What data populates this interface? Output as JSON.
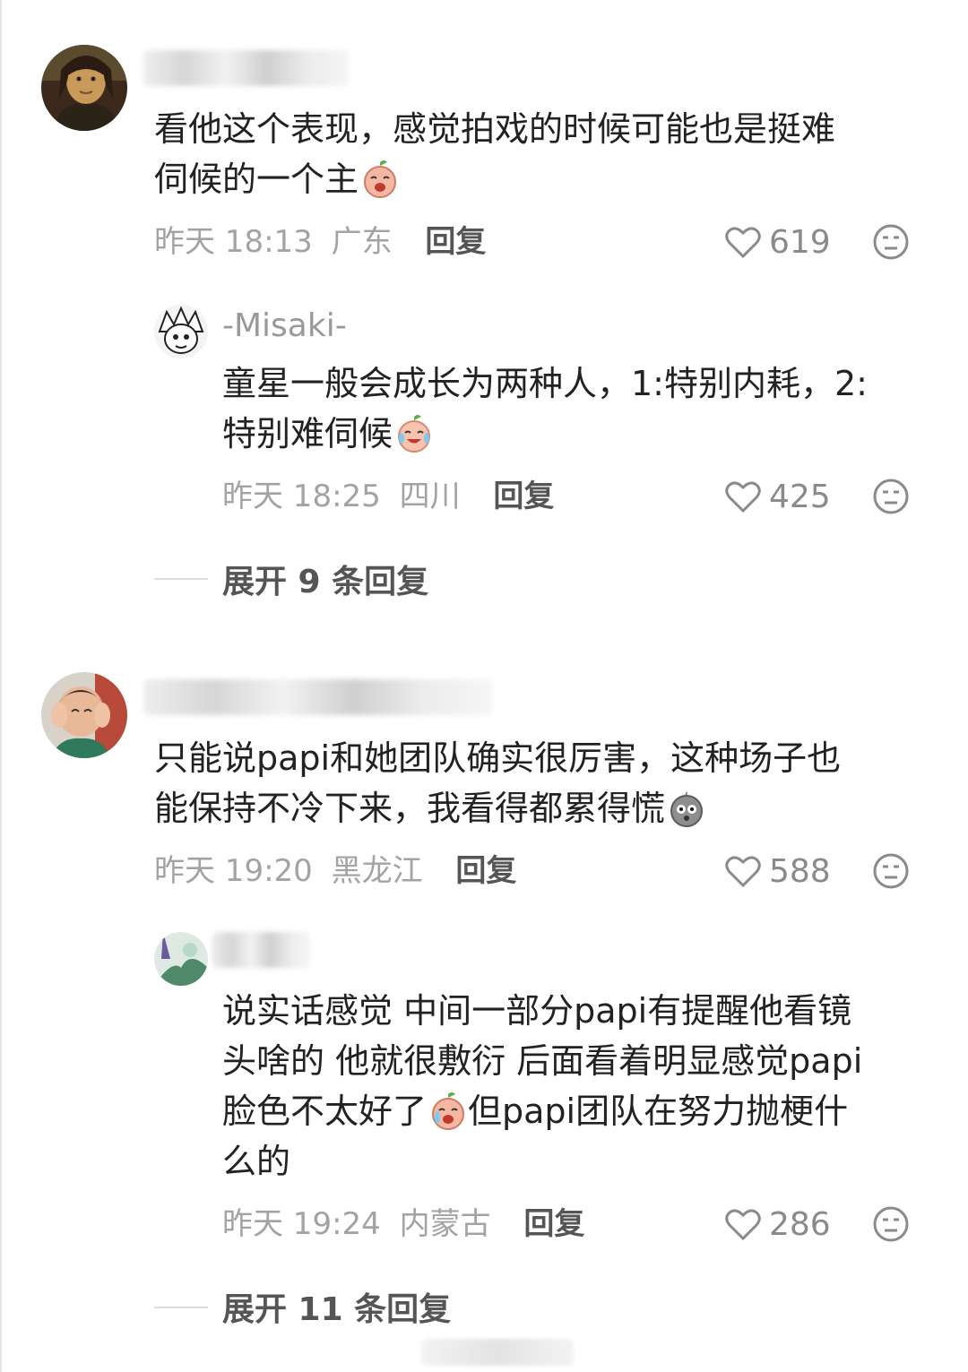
{
  "comments": [
    {
      "text_lines": [
        "看他这个表现，感觉拍戏的时候可能也是挺难",
        "伺候的一个主"
      ],
      "sticker": "crying-peach-emoji",
      "time": "昨天 18:13",
      "location": "广东",
      "reply_label": "回复",
      "likes": "619",
      "replies": [
        {
          "username": "-Misaki-",
          "text_lines": [
            "童星一般会成长为两种人，1:特别内耗，2:",
            "特别难伺候"
          ],
          "sticker": "laugh-cry-peach-emoji",
          "time": "昨天 18:25",
          "location": "四川",
          "reply_label": "回复",
          "likes": "425"
        }
      ],
      "expand_label": "展开 9 条回复"
    },
    {
      "text_lines": [
        "只能说papi和她团队确实很厉害，这种场子也",
        "能保持不冷下来，我看得都累得慌"
      ],
      "sticker": "shocked-bird-emoji",
      "time": "昨天 19:20",
      "location": "黑龙江",
      "reply_label": "回复",
      "likes": "588",
      "replies": [
        {
          "text_lines": [
            "说实话感觉 中间一部分papi有提醒他看镜",
            "头啥的 他就很敷衍 后面看着明显感觉papi",
            "脸色不太好了",
            "但papi团队在努力抛梗什",
            "么的"
          ],
          "sticker": "crying-peach-emoji",
          "time": "昨天 19:24",
          "location": "内蒙古",
          "reply_label": "回复",
          "likes": "286"
        }
      ],
      "expand_label": "展开 11 条回复"
    }
  ],
  "colors": {
    "text": "#222222",
    "meta": "#a3a3a3",
    "reply": "#555555",
    "icon": "#8a8a8a"
  }
}
